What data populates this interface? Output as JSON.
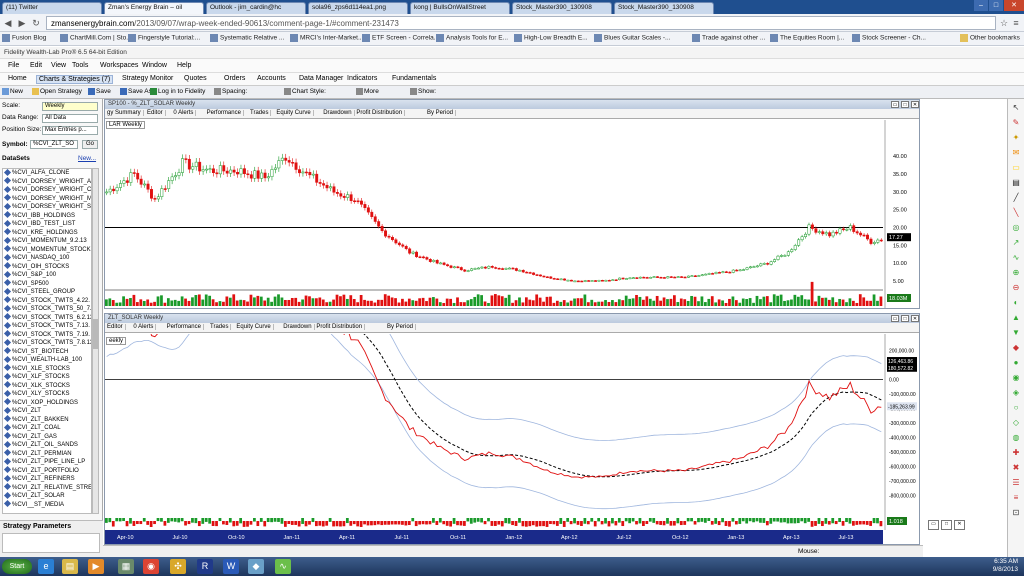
{
  "browser": {
    "tabs": [
      {
        "label": "(11) Twitter",
        "active": false
      },
      {
        "label": "Zman's Energy Brain – oil",
        "active": true
      },
      {
        "label": "Outlook - jim_cardin@hc",
        "active": false
      },
      {
        "label": "sola96_zps6d114ea1.png",
        "active": false
      },
      {
        "label": "kong | BullsOnWallStreet",
        "active": false
      },
      {
        "label": "Stock_Master390_130908",
        "active": false
      },
      {
        "label": "Stock_Master390_130908",
        "active": false
      }
    ],
    "url_host": "zmansenergybrain.com",
    "url_path": "/2013/09/07/wrap-week-ended-90613/comment-page-1/#comment-231473",
    "bookmarks": [
      "Fusion Blog",
      "ChartMill.Com | Sto...",
      "Fingerstyle Tutorial:...",
      "Systematic Relative ...",
      "MRCI's Inter-Market...",
      "ETF Screen - Correla...",
      "Analysis Tools for E...",
      "High-Low Breadth E...",
      "Blues Guitar Scales -...",
      "Trade against other ...",
      "The Equities Room |...",
      "Stock Screener - Ch..."
    ],
    "other_bookmarks": "Other bookmarks"
  },
  "app": {
    "title": "Fidelity Wealth-Lab Pro® 6.5   64-bit Edition",
    "menu": [
      "File",
      "Edit",
      "View",
      "Tools",
      "Workspaces",
      "Window",
      "Help"
    ],
    "modes": [
      "Home",
      "Charts & Strategies (7)",
      "Strategy Monitor",
      "Quotes",
      "Orders",
      "Accounts",
      "Data Manager",
      "Indicators",
      "Fundamentals"
    ],
    "toolbar": [
      "New",
      "Open Strategy",
      "Save",
      "Save As",
      "Log in to Fidelity",
      "Spacing:",
      "Chart Style:",
      "More",
      "Show:"
    ]
  },
  "left": {
    "scale_label": "Scale:",
    "scale_value": "Weekly",
    "range_label": "Data Range:",
    "range_value": "All Data",
    "pos_label": "Position Size:",
    "pos_value": "Max Entries p...",
    "symbol_label": "Symbol:",
    "symbol_value": "%CVI_ZLT_SO",
    "go": "Go",
    "datasets_label": "DataSets",
    "new_label": "New...",
    "datasets": [
      "%CVI_ALFA_CLONE",
      "%CVI_DORSEY_WRIGHT_A",
      "%CVI_DORSEY_WRIGHT_C",
      "%CVI_DORSEY_WRIGHT_M",
      "%CVI_DORSEY_WRIGHT_S",
      "%CVI_IBB_HOLDINGS",
      "%CVI_IBD_TEST_LIST",
      "%CVI_KRE_HOLDINGS",
      "%CVI_MOMENTUM_9.2.13",
      "%CVI_MOMENTUM_STOCKS",
      "%CVI_NASDAQ_100",
      "%CVI_OIH_STOCKS",
      "%CVI_S&P_100",
      "%CVI_SP500",
      "%CVI_STEEL_GROUP",
      "%CVI_STOCK_TWITS_4.22.",
      "%CVI_STOCK_TWITS_50_7.",
      "%CVI_STOCK_TWITS_6.2.13",
      "%CVI_STOCK_TWITS_7.13.",
      "%CVI_STOCK_TWITS_7.19.",
      "%CVI_STOCK_TWITS_7.8.13",
      "%CVI_ST_BIOTECH",
      "%CVI_WEALTH-LAB_100",
      "%CVI_XLE_STOCKS",
      "%CVI_XLF_STOCKS",
      "%CVI_XLK_STOCKS",
      "%CVI_XLY_STOCKS",
      "%CVI_XOP_HOLDINGS",
      "%CVI_ZLT",
      "%CVI_ZLT_BAKKEN",
      "%CVI_ZLT_COAL",
      "%CVI_ZLT_GAS",
      "%CVI_ZLT_OIL_SANDS",
      "%CVI_ZLT_PERMIAN",
      "%CVI_ZLT_PIPE_LINE_LP",
      "%CVI_ZLT_PORTFOLIO",
      "%CVI_ZLT_REFINERS",
      "%CVI_ZLT_RELATIVE_STRE",
      "%CVI_ZLT_SOLAR",
      "%CVI__ST_MEDIA"
    ],
    "strategy_params": "Strategy Parameters"
  },
  "chart1": {
    "title": "SP100 - %_ZLT_SOLAR Weekly",
    "tabs": [
      "gy Summary",
      "Editor",
      "0 Alerts",
      "Performance",
      "Trades",
      "Equity Curve",
      "Drawdown",
      "Profit Distribution",
      "By Period"
    ],
    "legend": "LAR Weekly",
    "yticks": [
      "40.00",
      "35.00",
      "30.00",
      "25.00",
      "20.00",
      "15.00",
      "10.00",
      "5.00"
    ],
    "last_price": "17.27",
    "volume_label": "18.03M",
    "hline": 20.0,
    "price_range": [
      3,
      44
    ]
  },
  "chart2": {
    "title": "ZLT_SOLAR Weekly",
    "tabs": [
      "Editor",
      "0 Alerts",
      "Performance",
      "Trades",
      "Equity Curve",
      "Drawdown",
      "Profit Distribution",
      "By Period"
    ],
    "legend": "eekly",
    "yticks": [
      "200,000.00",
      "100,000.00",
      "0.00",
      "-100,000.00",
      "-200,000.00",
      "-300,000.00",
      "-400,000.00",
      "-500,000.00",
      "-600,000.00",
      "-700,000.00",
      "-800,000.00"
    ],
    "label_top": "126,463.86",
    "label_mid": "180,572.82",
    "label_low": "-185,263.99",
    "osc_label": "1.018",
    "xlabels": [
      "Apr-10",
      "Jul-10",
      "Oct-10",
      "Jan-11",
      "Apr-11",
      "Jul-11",
      "Oct-11",
      "Jan-12",
      "Apr-12",
      "Jul-12",
      "Oct-12",
      "Jan-13",
      "Apr-13",
      "Jul-13"
    ]
  },
  "status": {
    "mouse": "Mouse:"
  },
  "taskbar": {
    "start": "Start",
    "time": "6:35 AM",
    "date": "9/8/2013"
  },
  "colors": {
    "up": "#1a9a2a",
    "down": "#e01010",
    "band": "#9fb6de",
    "avg": "#000000",
    "osc_pos": "#1a9a2a",
    "osc_neg": "#e01010"
  }
}
